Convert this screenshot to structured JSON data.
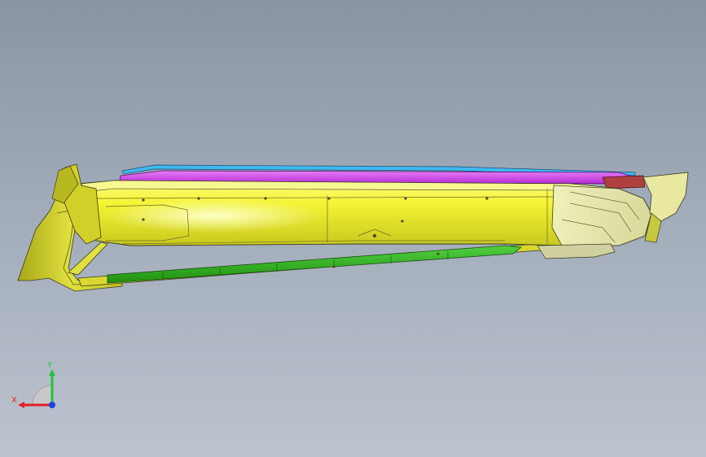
{
  "viewport": {
    "background_top": "#8995a5",
    "background_bottom": "#bcc3ce"
  },
  "model": {
    "part_colors": {
      "housing": "#f2f230",
      "housing_highlight": "#ffffa8",
      "housing_shadow": "#b8b820",
      "end_cap": "#e8e8c0",
      "rail_magenta": "#d040e8",
      "rail_cyan": "#40b8f0",
      "strip_green": "#30b820",
      "bracket_red": "#b04040",
      "edge": "#3a3a20"
    }
  },
  "triad": {
    "x_label": "X",
    "y_label": "Y",
    "x_color": "#e02020",
    "y_color": "#20c040",
    "z_color": "#2040e0"
  }
}
